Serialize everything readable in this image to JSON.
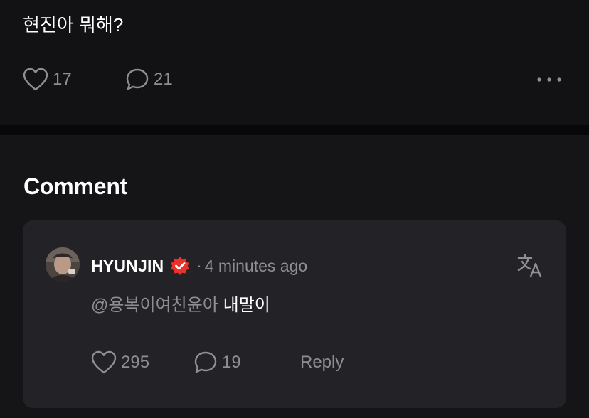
{
  "post": {
    "text": "현진아 뭐해?",
    "likes": "17",
    "comments": "21",
    "more_icon": "more-horizontal-icon"
  },
  "comment_section": {
    "title": "Comment",
    "comment": {
      "author": "HYUNJIN",
      "verified_icon": "verified-badge-icon",
      "separator": "·",
      "time": "4 minutes ago",
      "mention": "@용복이여친윤아",
      "text": "내말이",
      "likes": "295",
      "replies": "19",
      "reply_label": "Reply",
      "translate_icon": "translate-icon"
    }
  },
  "colors": {
    "background": "#121214",
    "card": "#232327",
    "muted": "#8e8e93",
    "badge": "#e8322b"
  }
}
